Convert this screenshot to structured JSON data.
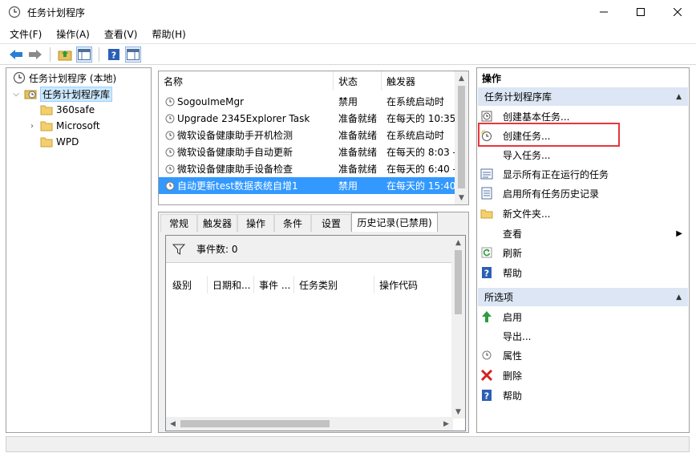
{
  "window": {
    "title": "任务计划程序"
  },
  "menu": [
    "文件(F)",
    "操作(A)",
    "查看(V)",
    "帮助(H)"
  ],
  "tree": {
    "root": "任务计划程序 (本地)",
    "library": "任务计划程序库",
    "children": [
      "360safe",
      "Microsoft",
      "WPD"
    ]
  },
  "tasklist": {
    "columns": [
      "名称",
      "状态",
      "触发器"
    ],
    "rows": [
      {
        "name": "SogouImeMgr",
        "status": "禁用",
        "trigger": "在系统启动时"
      },
      {
        "name": "Upgrade 2345Explorer Task",
        "status": "准备就绪",
        "trigger": "在每天的 10:35"
      },
      {
        "name": "微软设备健康助手开机检测",
        "status": "准备就绪",
        "trigger": "在系统启动时"
      },
      {
        "name": "微软设备健康助手自动更新",
        "status": "准备就绪",
        "trigger": "在每天的 8:03 -"
      },
      {
        "name": "微软设备健康助手设备检查",
        "status": "准备就绪",
        "trigger": "在每天的 6:40 -"
      },
      {
        "name": "自动更新test数据表统自增1",
        "status": "禁用",
        "trigger": "在每天的 15:40"
      }
    ]
  },
  "tabs": [
    "常规",
    "触发器",
    "操作",
    "条件",
    "设置",
    "历史记录(已禁用)"
  ],
  "history": {
    "event_count": "事件数: 0",
    "columns": [
      "级别",
      "日期和...",
      "事件 ...",
      "任务类别",
      "操作代码"
    ]
  },
  "actions": {
    "header": "操作",
    "section1": {
      "title": "任务计划程序库",
      "items": [
        "创建基本任务...",
        "创建任务...",
        "导入任务...",
        "显示所有正在运行的任务",
        "启用所有任务历史记录",
        "新文件夹...",
        "查看",
        "刷新",
        "帮助"
      ]
    },
    "section2": {
      "title": "所选项",
      "items": [
        "启用",
        "导出...",
        "属性",
        "删除",
        "帮助"
      ]
    }
  },
  "colors": {
    "selection": "#3399ff",
    "section_bg": "#dce6f4",
    "highlight_border": "#e8353e"
  }
}
